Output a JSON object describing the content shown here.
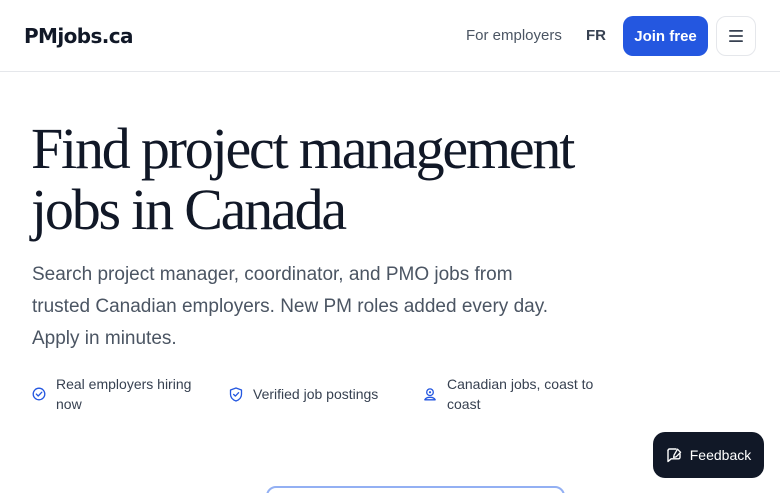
{
  "header": {
    "logo": "PMjobs.ca",
    "nav_employers": "For employers",
    "nav_language": "FR",
    "join_label": "Join free"
  },
  "hero": {
    "title_line1": "Find project management",
    "title_line2": "jobs in Canada",
    "subtitle": "Search project manager, coordinator, and PMO jobs from trusted Canadian employers. New PM roles added every day. Apply in minutes."
  },
  "features": [
    {
      "label": "Real employers hiring now",
      "icon": "check-badge-icon"
    },
    {
      "label": "Verified job postings",
      "icon": "shield-check-icon"
    },
    {
      "label": "Canadian jobs, coast to coast",
      "icon": "map-pin-icon"
    }
  ],
  "feedback": {
    "label": "Feedback",
    "icon": "feedback-icon"
  },
  "colors": {
    "accent": "#2457e0",
    "dark": "#111827",
    "muted": "#4b5563"
  }
}
